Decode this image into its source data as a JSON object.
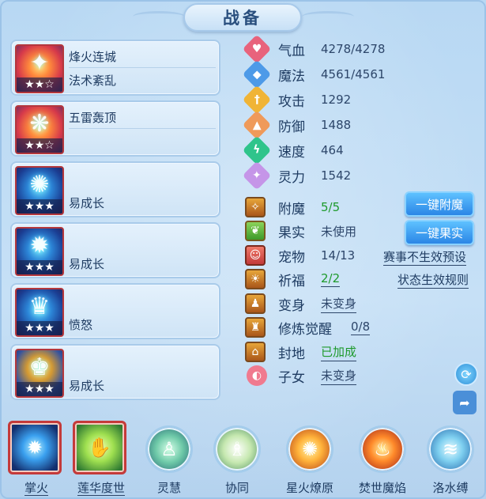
{
  "title": "战备",
  "skills": [
    {
      "name_top": "烽火连城",
      "name_bottom": "法术紊乱",
      "stars": "★★☆"
    },
    {
      "name_top": "五雷轰顶",
      "name_bottom": "",
      "stars": "★★☆"
    },
    {
      "name_mid": "易成长",
      "stars": "★★★"
    },
    {
      "name_mid": "易成长",
      "stars": "★★★"
    },
    {
      "name_mid": "愤怒",
      "stars": "★★★"
    },
    {
      "name_mid": "易成长",
      "stars": "★★★"
    }
  ],
  "stats": [
    {
      "label": "气血",
      "value": "4278/4278",
      "icon": "heart-icon",
      "color": "#e8637c"
    },
    {
      "label": "魔法",
      "value": "4561/4561",
      "icon": "shield-icon",
      "color": "#4d9ae8"
    },
    {
      "label": "攻击",
      "value": "1292",
      "icon": "sword-icon",
      "color": "#f0b436"
    },
    {
      "label": "防御",
      "value": "1488",
      "icon": "armor-icon",
      "color": "#ef9a5a"
    },
    {
      "label": "速度",
      "value": "464",
      "icon": "lightning-icon",
      "color": "#2fc48b"
    },
    {
      "label": "灵力",
      "value": "1542",
      "icon": "sparkle-icon",
      "color": "#c595e8"
    }
  ],
  "extras": [
    {
      "label": "附魔",
      "value": "5/5",
      "icon": "enchant-icon"
    },
    {
      "label": "果实",
      "value": "未使用",
      "icon": "fruit-icon"
    },
    {
      "label": "宠物",
      "value": "14/13",
      "icon": "pet-icon"
    },
    {
      "label": "祈福",
      "value": "2/2",
      "icon": "blessing-icon"
    },
    {
      "label": "变身",
      "value": "未变身",
      "icon": "transform-icon"
    },
    {
      "label": "修炼觉醒",
      "value": "0/8",
      "icon": "cultivation-icon"
    },
    {
      "label": "封地",
      "value": "已加成",
      "icon": "fief-icon"
    },
    {
      "label": "子女",
      "value": "未变身",
      "icon": "child-icon"
    }
  ],
  "buttons": {
    "enchant": "一键附魔",
    "fruit": "一键果实"
  },
  "links": {
    "pet_note": "赛事不生效预设",
    "blessing_note": "状态生效规则"
  },
  "bottom_skills": [
    {
      "label": "掌火",
      "icon": "palm-fire-icon"
    },
    {
      "label": "莲华度世",
      "icon": "lotus-hand-icon"
    },
    {
      "label": "灵慧",
      "icon": "spirit-icon"
    },
    {
      "label": "协同",
      "icon": "synergy-icon"
    },
    {
      "label": "星火燎原",
      "icon": "starfire-icon"
    },
    {
      "label": "焚世魔焰",
      "icon": "flame-icon"
    },
    {
      "label": "洛水缚",
      "icon": "water-bind-icon"
    }
  ]
}
